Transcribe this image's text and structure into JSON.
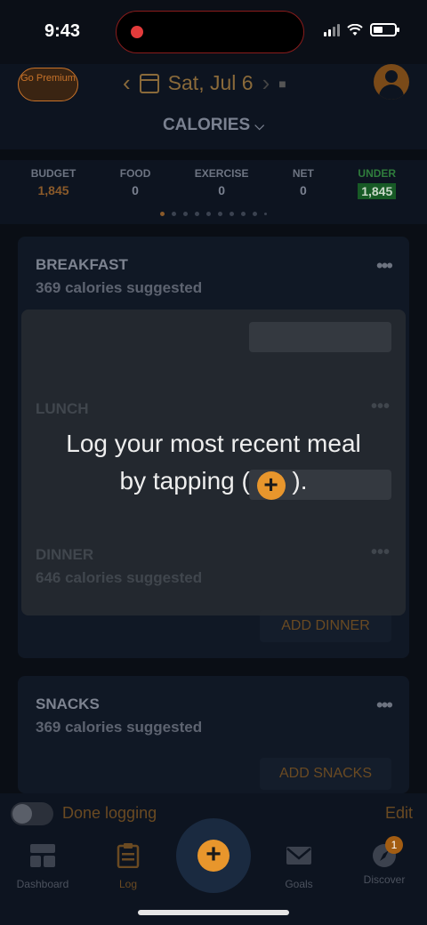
{
  "status_bar": {
    "time": "9:43"
  },
  "header": {
    "go_premium": "Go Premium",
    "date": "Sat, Jul 6"
  },
  "summary": {
    "selector": "CALORIES",
    "columns": [
      {
        "label": "BUDGET",
        "value": "1,845"
      },
      {
        "label": "FOOD",
        "value": "0"
      },
      {
        "label": "EXERCISE",
        "value": "0"
      },
      {
        "label": "NET",
        "value": "0"
      },
      {
        "label": "UNDER",
        "value": "1,845"
      }
    ]
  },
  "meals": {
    "breakfast": {
      "title": "BREAKFAST",
      "sub": "369 calories suggested"
    },
    "lunch": {
      "title": "LUNCH"
    },
    "dinner": {
      "title": "DINNER",
      "sub": "646 calories suggested",
      "button": "ADD DINNER"
    },
    "snacks": {
      "title": "SNACKS",
      "sub": "369 calories suggested",
      "button": "ADD SNACKS"
    }
  },
  "tip": {
    "line1": "Log your most recent meal",
    "line2_pre": "by tapping (",
    "line2_post": ")."
  },
  "bottom": {
    "done_logging": "Done logging",
    "edit": "Edit",
    "nav": [
      {
        "label": "Dashboard",
        "icon": "dashboard-icon"
      },
      {
        "label": "Log",
        "icon": "clipboard-icon"
      },
      {
        "label": "Goals",
        "icon": "envelope-icon"
      },
      {
        "label": "Discover",
        "icon": "compass-icon",
        "badge": "1"
      }
    ]
  }
}
